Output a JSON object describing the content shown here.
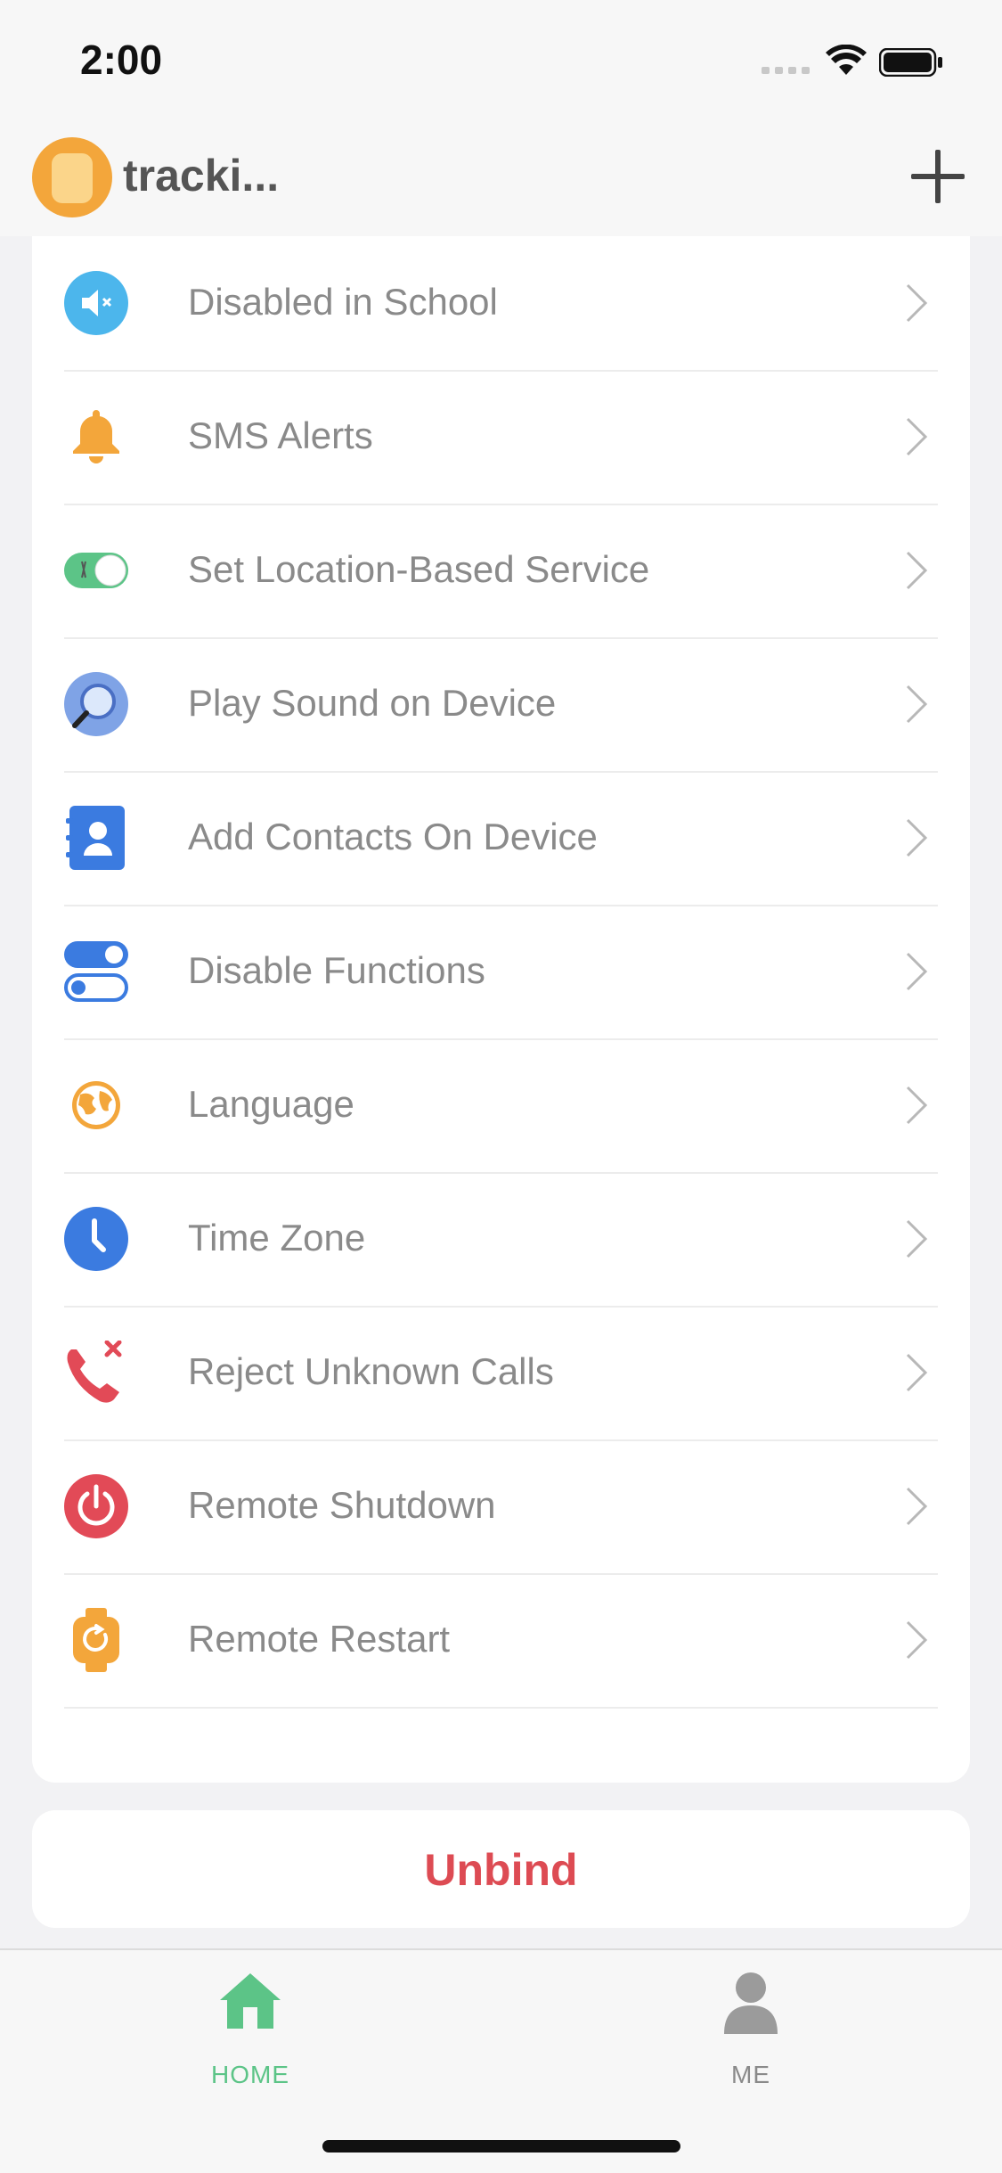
{
  "status_bar": {
    "time": "2:00"
  },
  "header": {
    "device_name": "tracki..."
  },
  "menu": [
    {
      "label": "Disabled in School",
      "icon": "speaker-muted-icon"
    },
    {
      "label": "SMS Alerts",
      "icon": "bell-icon"
    },
    {
      "label": "Set Location-Based Service",
      "icon": "toggle-icon"
    },
    {
      "label": "Play Sound on Device",
      "icon": "search-sound-icon"
    },
    {
      "label": "Add Contacts On Device",
      "icon": "contacts-book-icon"
    },
    {
      "label": "Disable Functions",
      "icon": "switches-icon"
    },
    {
      "label": "Language",
      "icon": "globe-icon"
    },
    {
      "label": "Time Zone",
      "icon": "clock-icon"
    },
    {
      "label": "Reject Unknown Calls",
      "icon": "phone-reject-icon"
    },
    {
      "label": "Remote Shutdown",
      "icon": "power-icon"
    },
    {
      "label": "Remote Restart",
      "icon": "watch-restart-icon"
    }
  ],
  "unbind_label": "Unbind",
  "tabs": [
    {
      "label": "HOME",
      "icon": "home-icon",
      "active": true
    },
    {
      "label": "ME",
      "icon": "person-icon",
      "active": false
    }
  ],
  "colors": {
    "accent_green": "#5cc487",
    "danger_red": "#dd4b53",
    "orange": "#f3a63b",
    "blue": "#3b7be0"
  }
}
